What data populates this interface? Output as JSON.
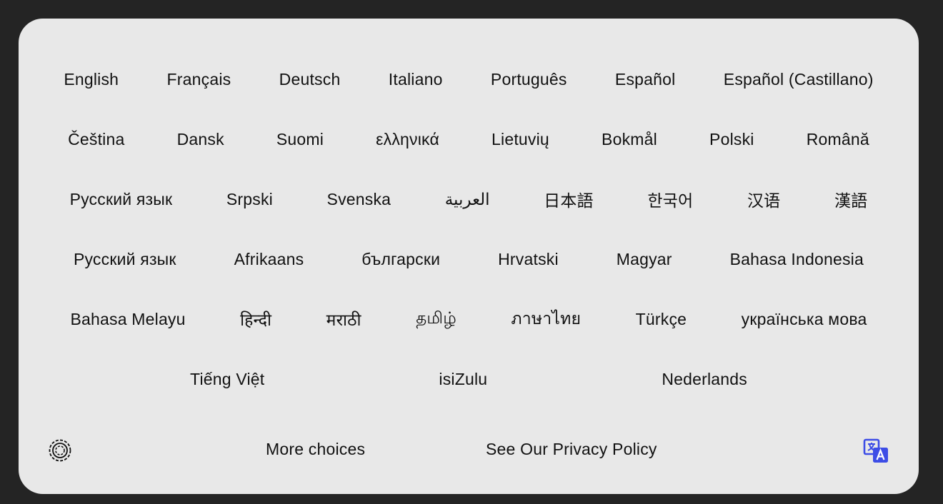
{
  "languages": {
    "row0": [
      "English",
      "Français",
      "Deutsch",
      "Italiano",
      "Português",
      "Español",
      "Español (Castillano)"
    ],
    "row1": [
      "Čeština",
      "Dansk",
      "Suomi",
      "ελληνικά",
      "Lietuvių",
      "Bokmål",
      "Polski",
      "Română"
    ],
    "row2": [
      "Русский язык",
      "Srpski",
      "Svenska",
      "العربية",
      "日本語",
      "한국어",
      "汉语",
      "漢語"
    ],
    "row3": [
      "Русский язык",
      "Afrikaans",
      "български",
      "Hrvatski",
      "Magyar",
      "Bahasa Indonesia"
    ],
    "row4": [
      "Bahasa Melayu",
      "हिन्दी",
      "मराठी",
      "தமிழ்",
      "ภาษาไทย",
      "Türkçe",
      "українська мова"
    ],
    "row5": [
      "Tiếng Việt",
      "isiZulu",
      "Nederlands"
    ]
  },
  "footer": {
    "more_choices": "More choices",
    "privacy_policy": "See Our Privacy Policy"
  },
  "icons": {
    "logo": "cookie-consent-logo-icon",
    "translate": "translate-icon"
  },
  "colors": {
    "background": "#242424",
    "panel": "#e8e8e8",
    "text": "#111111",
    "translate_icon": "#3d4de6"
  }
}
